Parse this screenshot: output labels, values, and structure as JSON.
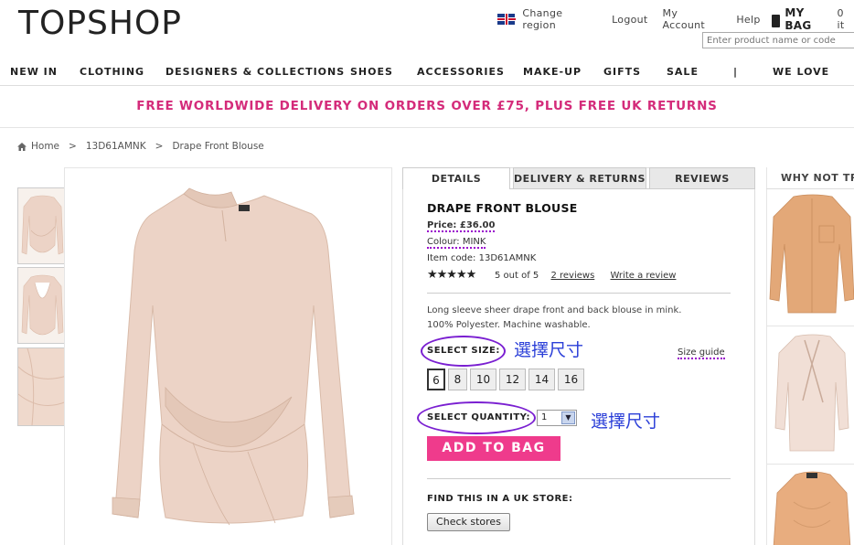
{
  "header": {
    "logo": "TOPSHOP",
    "links": [
      "Change region",
      "Logout",
      "My Account",
      "Help"
    ],
    "bag_label": "MY BAG",
    "bag_count": "0 it",
    "search_placeholder": "Enter product name or code"
  },
  "nav": {
    "items": [
      "NEW IN",
      "CLOTHING",
      "DESIGNERS & COLLECTIONS",
      "SHOES",
      "ACCESSORIES",
      "MAKE-UP",
      "GIFTS",
      "SALE",
      "|",
      "WE LOVE"
    ]
  },
  "promo": "FREE WORLDWIDE DELIVERY ON ORDERS OVER £75, PLUS FREE UK RETURNS",
  "breadcrumb": {
    "home": "Home",
    "sep": ">",
    "code": "13D61AMNK",
    "current": "Drape Front Blouse"
  },
  "tabs": [
    "DETAILS",
    "DELIVERY & RETURNS",
    "REVIEWS"
  ],
  "product": {
    "name": "DRAPE FRONT BLOUSE",
    "price": "Price: £36.00",
    "colour": "Colour: MINK",
    "item_code": "Item code: 13D61AMNK",
    "stars": "★★★★★",
    "rating_text": "5 out of 5",
    "reviews_link": "2 reviews",
    "write_review": "Write a review",
    "description_1": "Long sleeve sheer drape front and back blouse in mink.",
    "description_2": "100% Polyester. Machine washable."
  },
  "size": {
    "label": "SELECT SIZE:",
    "annotation": "選擇尺寸",
    "guide": "Size guide",
    "options": [
      "6",
      "8",
      "10",
      "12",
      "14",
      "16"
    ],
    "selected": "6"
  },
  "quantity": {
    "label": "SELECT QUANTITY:",
    "value": "1",
    "annotation": "選擇尺寸"
  },
  "add_to_bag": "ADD TO BAG",
  "store": {
    "label": "FIND THIS IN A UK STORE:",
    "button": "Check stores"
  },
  "sidebar": {
    "title": "WHY NOT TRY"
  },
  "colors": {
    "brand_pink": "#d42b7a",
    "button_pink": "#ef3b8c",
    "annotation_purple": "#7a1fd1",
    "annotation_blue": "#2b3fd8",
    "garment": "#ecd3c6"
  }
}
